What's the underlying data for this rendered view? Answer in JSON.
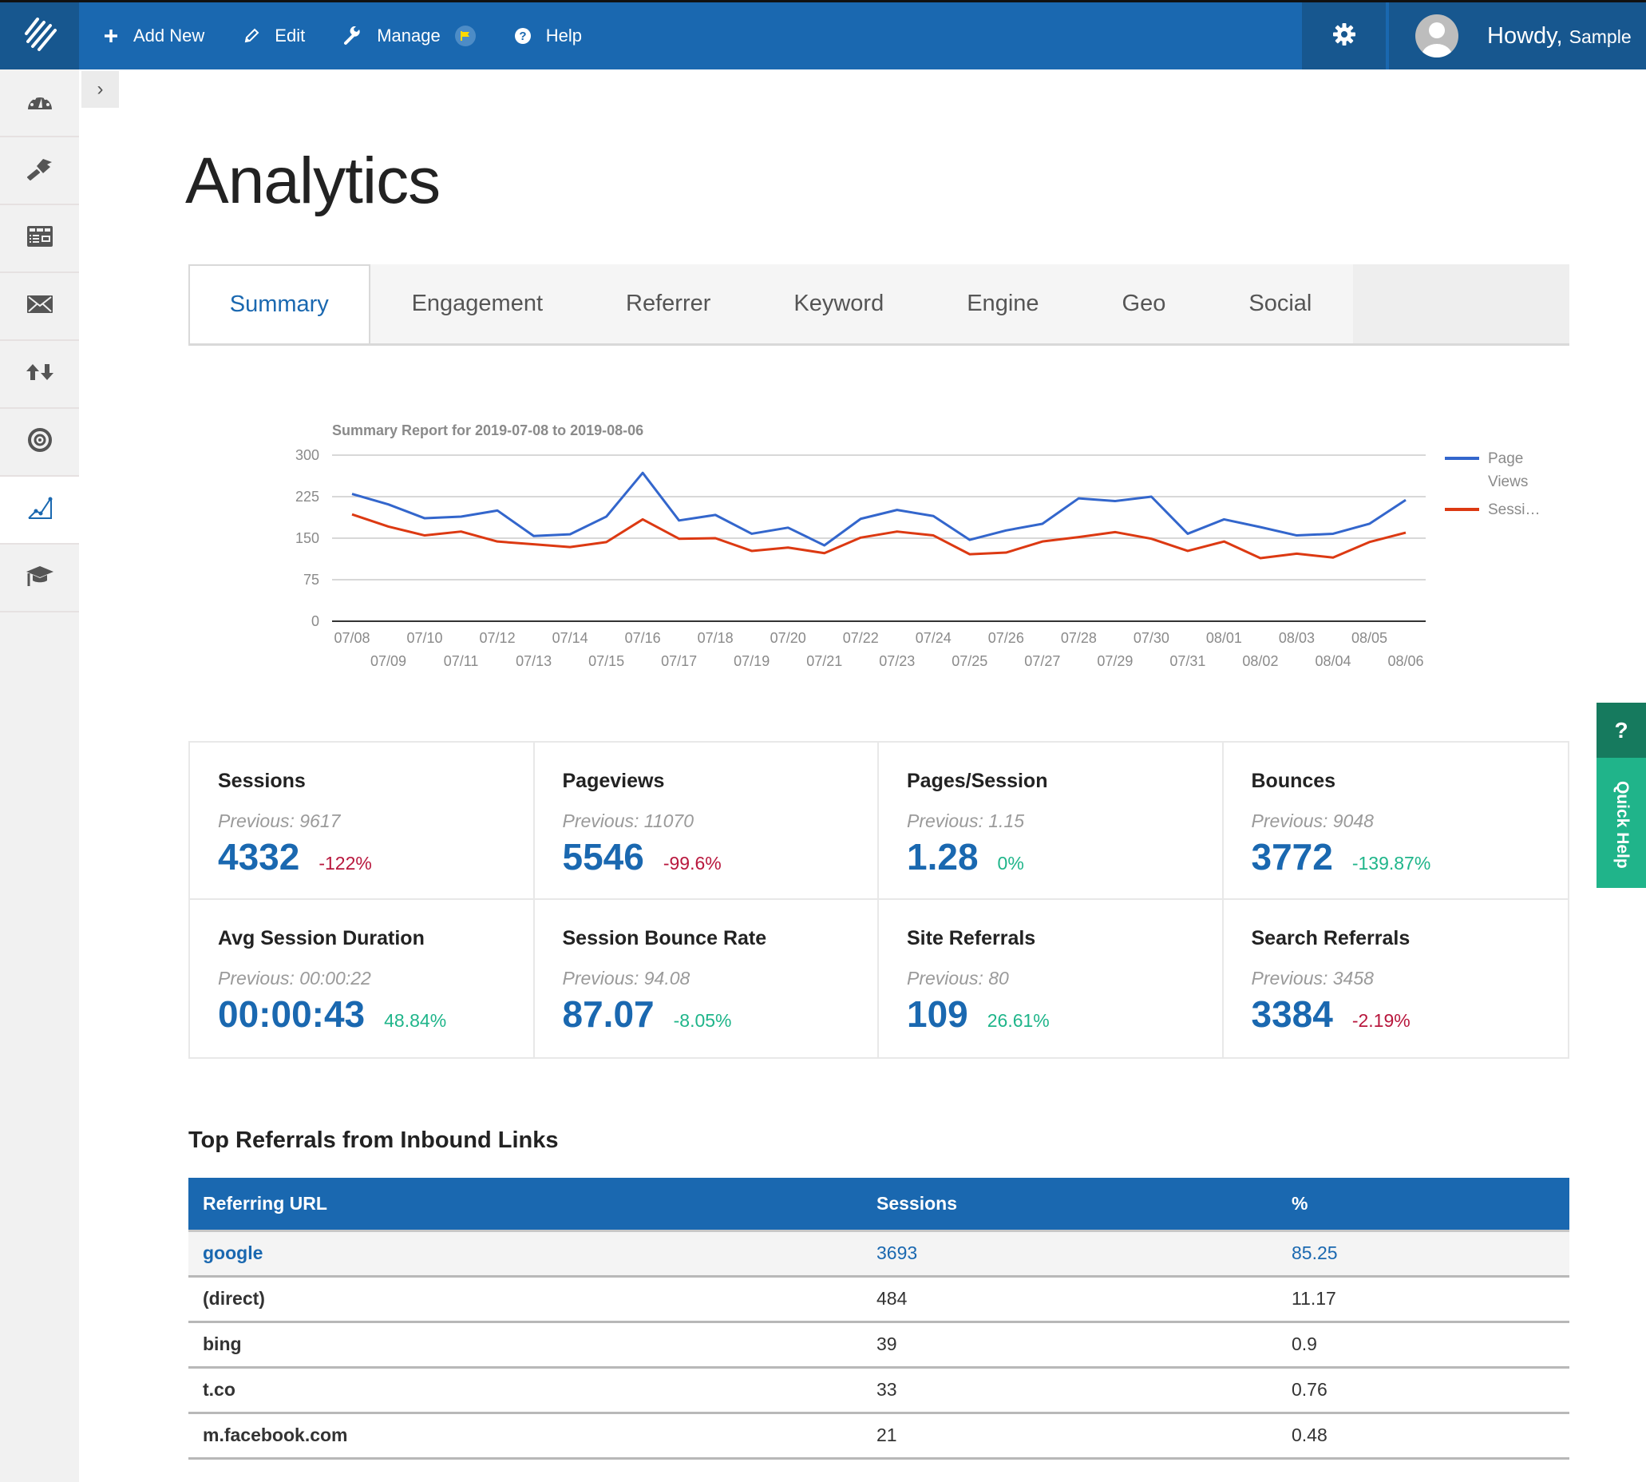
{
  "topbar": {
    "logo": "logo-icon",
    "nav": [
      {
        "label": "Add New",
        "icon": "plus-icon"
      },
      {
        "label": "Edit",
        "icon": "pencil-icon"
      },
      {
        "label": "Manage",
        "icon": "wrench-icon",
        "badge_icon": "flag-icon"
      },
      {
        "label": "Help",
        "icon": "question-icon"
      }
    ],
    "settings_icon": "gear-icon",
    "greeting": "Howdy,",
    "username": "Sample"
  },
  "sidebar": {
    "items": [
      {
        "name": "dashboard",
        "icon": "dashboard-gauge-icon"
      },
      {
        "name": "design",
        "icon": "paintbrush-icon"
      },
      {
        "name": "layout",
        "icon": "layout-grid-icon"
      },
      {
        "name": "email",
        "icon": "envelope-icon"
      },
      {
        "name": "import-export",
        "icon": "up-down-arrows-icon"
      },
      {
        "name": "goals",
        "icon": "target-icon"
      },
      {
        "name": "analytics",
        "icon": "line-chart-icon",
        "active": true
      },
      {
        "name": "learn",
        "icon": "graduation-cap-icon"
      }
    ],
    "collapse_label": "›"
  },
  "page": {
    "title": "Analytics"
  },
  "tabs": [
    {
      "label": "Summary",
      "active": true
    },
    {
      "label": "Engagement"
    },
    {
      "label": "Referrer"
    },
    {
      "label": "Keyword"
    },
    {
      "label": "Engine"
    },
    {
      "label": "Geo"
    },
    {
      "label": "Social"
    }
  ],
  "chart_data": {
    "type": "line",
    "title": "Summary Report for 2019-07-08 to 2019-08-06",
    "xlabel": "",
    "ylabel": "",
    "ylim": [
      0,
      300
    ],
    "yticks": [
      0,
      75,
      150,
      225,
      300
    ],
    "grid": true,
    "legend_position": "right",
    "x": [
      "07/08",
      "07/09",
      "07/10",
      "07/11",
      "07/12",
      "07/13",
      "07/14",
      "07/15",
      "07/16",
      "07/17",
      "07/18",
      "07/19",
      "07/20",
      "07/21",
      "07/22",
      "07/23",
      "07/24",
      "07/25",
      "07/26",
      "07/27",
      "07/28",
      "07/29",
      "07/30",
      "07/31",
      "08/01",
      "08/02",
      "08/03",
      "08/04",
      "08/05",
      "08/06"
    ],
    "series": [
      {
        "name": "Page Views",
        "legend_label_lines": [
          "Page",
          "Views"
        ],
        "color": "#3366cc",
        "values": [
          230,
          211,
          186,
          189,
          200,
          154,
          157,
          189,
          268,
          182,
          192,
          158,
          169,
          137,
          185,
          201,
          190,
          147,
          164,
          176,
          222,
          217,
          225,
          158,
          184,
          170,
          155,
          158,
          176,
          219
        ]
      },
      {
        "name": "Sessions",
        "legend_label_lines": [
          "Sessi…"
        ],
        "color": "#dc3912",
        "values": [
          193,
          171,
          155,
          162,
          144,
          139,
          134,
          143,
          184,
          149,
          150,
          127,
          133,
          123,
          151,
          162,
          155,
          121,
          124,
          144,
          152,
          161,
          149,
          127,
          144,
          114,
          122,
          115,
          143,
          160
        ]
      }
    ]
  },
  "stats": [
    {
      "label": "Sessions",
      "previous": "Previous: 9617",
      "value": "4332",
      "change": "-122%",
      "trend": "neg"
    },
    {
      "label": "Pageviews",
      "previous": "Previous: 11070",
      "value": "5546",
      "change": "-99.6%",
      "trend": "neg"
    },
    {
      "label": "Pages/Session",
      "previous": "Previous: 1.15",
      "value": "1.28",
      "change": "0%",
      "trend": "pos"
    },
    {
      "label": "Bounces",
      "previous": "Previous: 9048",
      "value": "3772",
      "change": "-139.87%",
      "trend": "pos"
    },
    {
      "label": "Avg Session Duration",
      "previous": "Previous: 00:00:22",
      "value": "00:00:43",
      "change": "48.84%",
      "trend": "pos"
    },
    {
      "label": "Session Bounce Rate",
      "previous": "Previous: 94.08",
      "value": "87.07",
      "change": "-8.05%",
      "trend": "pos"
    },
    {
      "label": "Site Referrals",
      "previous": "Previous: 80",
      "value": "109",
      "change": "26.61%",
      "trend": "pos"
    },
    {
      "label": "Search Referrals",
      "previous": "Previous: 3458",
      "value": "3384",
      "change": "-2.19%",
      "trend": "neg"
    }
  ],
  "referrals": {
    "title": "Top Referrals from Inbound Links",
    "columns": [
      "Referring URL",
      "Sessions",
      "%"
    ],
    "rows": [
      {
        "url": "google",
        "sessions": "3693",
        "percent": "85.25",
        "highlight": true
      },
      {
        "url": "(direct)",
        "sessions": "484",
        "percent": "11.17"
      },
      {
        "url": "bing",
        "sessions": "39",
        "percent": "0.9"
      },
      {
        "url": "t.co",
        "sessions": "33",
        "percent": "0.76"
      },
      {
        "url": "m.facebook.com",
        "sessions": "21",
        "percent": "0.48"
      }
    ]
  },
  "quick_help": {
    "icon_label": "?",
    "label": "Quick Help"
  },
  "colors": {
    "brand_blue": "#1a68b0",
    "brand_dark": "#17578f",
    "negative": "#b8173d",
    "positive": "#1fb58a",
    "quick_help": "#20b48a"
  }
}
